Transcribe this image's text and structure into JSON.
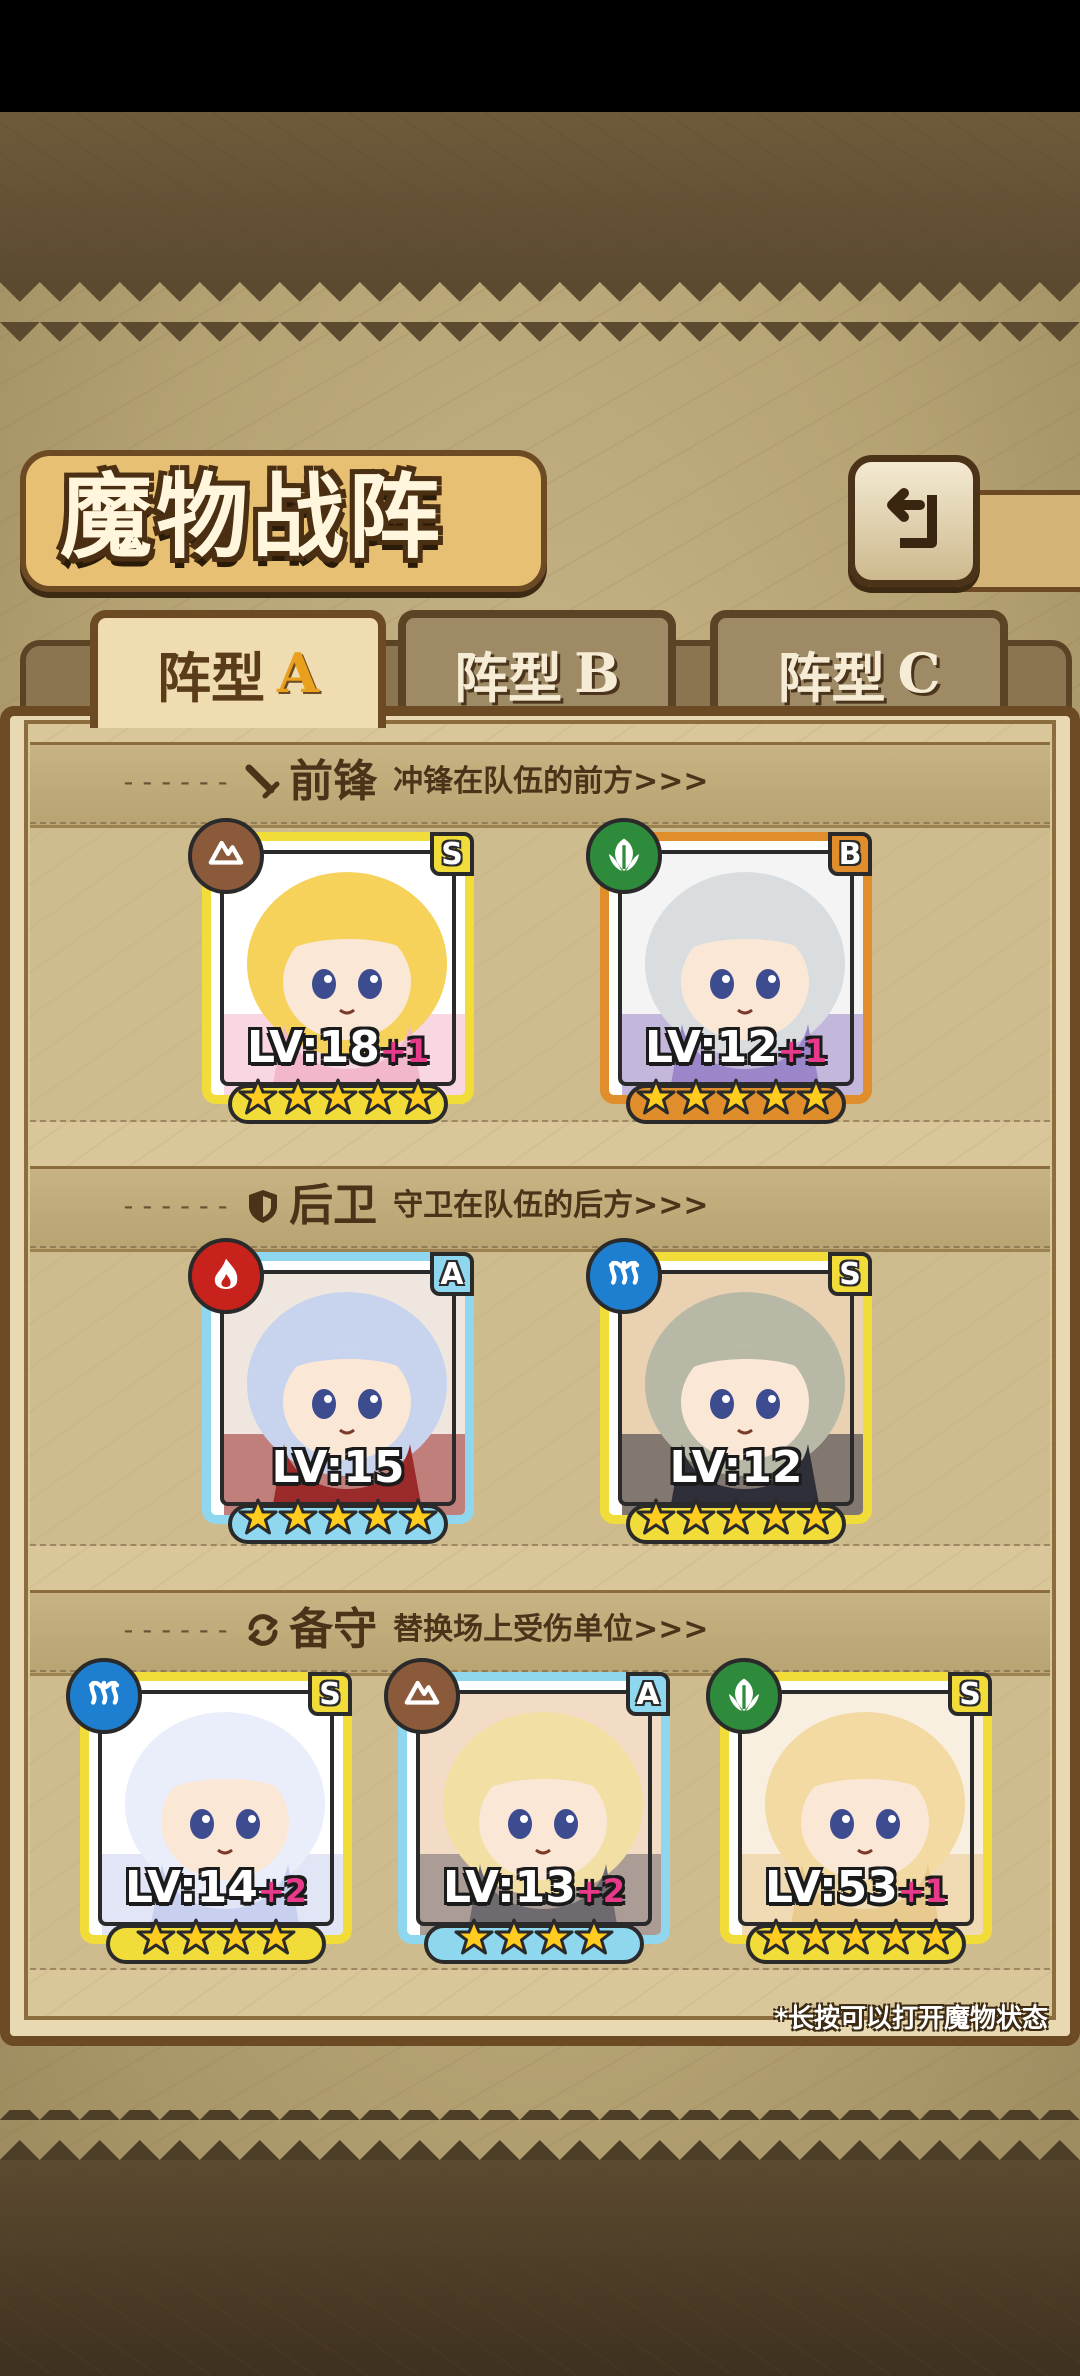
{
  "header": {
    "title": "魔物战阵"
  },
  "tabs": [
    {
      "label": "阵型",
      "letter": "A",
      "active": true
    },
    {
      "label": "阵型",
      "letter": "B",
      "active": false
    },
    {
      "label": "阵型",
      "letter": "C",
      "active": false
    }
  ],
  "sections": {
    "front": {
      "name": "前锋",
      "desc": "冲锋在队伍的前方>>>",
      "icon": "sword-icon"
    },
    "back": {
      "name": "后卫",
      "desc": "守卫在队伍的后方>>>",
      "icon": "shield-icon"
    },
    "reserve": {
      "name": "备守",
      "desc": "替换场上受伤单位>>>",
      "icon": "swap-icon"
    }
  },
  "units": [
    {
      "slot": "front-1",
      "grade": "S",
      "element": "earth",
      "level": "LV:18",
      "plus": "+1",
      "stars": 5,
      "frame": "yellow",
      "palette": [
        "#f6d25a",
        "#f3b7cc",
        "#ffffff"
      ]
    },
    {
      "slot": "front-2",
      "grade": "B",
      "element": "nature",
      "level": "LV:12",
      "plus": "+1",
      "stars": 5,
      "frame": "orange",
      "palette": [
        "#d9dde0",
        "#9a86c8",
        "#f4f4f4"
      ]
    },
    {
      "slot": "back-1",
      "grade": "A",
      "element": "fire",
      "level": "LV:15",
      "plus": "",
      "stars": 5,
      "frame": "blue",
      "palette": [
        "#c8d3ee",
        "#9b2a2a",
        "#efe7df"
      ]
    },
    {
      "slot": "back-2",
      "grade": "S",
      "element": "water",
      "level": "LV:12",
      "plus": "",
      "stars": 5,
      "frame": "yellow",
      "palette": [
        "#b7b9a6",
        "#2f2f3a",
        "#e9d1b2"
      ]
    },
    {
      "slot": "reserve-1",
      "grade": "S",
      "element": "water",
      "level": "LV:14",
      "plus": "+2",
      "stars": 4,
      "frame": "yellow",
      "palette": [
        "#e9eefa",
        "#c9d0ef",
        "#ffffff"
      ]
    },
    {
      "slot": "reserve-2",
      "grade": "A",
      "element": "earth",
      "level": "LV:13",
      "plus": "+2",
      "stars": 4,
      "frame": "blue",
      "palette": [
        "#f1dfa3",
        "#6f6a70",
        "#f3dcc6"
      ]
    },
    {
      "slot": "reserve-3",
      "grade": "S",
      "element": "nature",
      "level": "LV:53",
      "plus": "+1",
      "stars": 5,
      "frame": "yellow",
      "palette": [
        "#f3d9a2",
        "#e8c98e",
        "#f8efe1"
      ]
    }
  ],
  "footer": {
    "tip": "*长按可以打开魔物状态"
  }
}
